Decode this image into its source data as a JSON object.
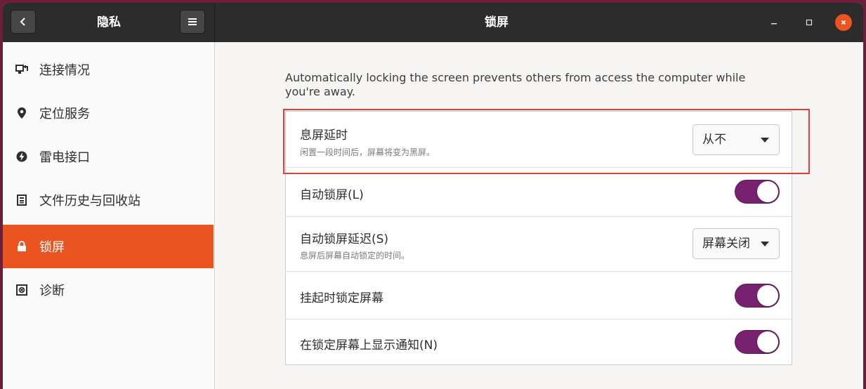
{
  "header": {
    "left_title": "隐私",
    "title": "锁屏"
  },
  "sidebar": {
    "items": [
      {
        "label": "连接情况",
        "icon": "network-icon"
      },
      {
        "label": "定位服务",
        "icon": "location-pin-icon"
      },
      {
        "label": "雷电接口",
        "icon": "thunderbolt-icon"
      },
      {
        "label": "文件历史与回收站",
        "icon": "file-history-icon"
      },
      {
        "label": "锁屏",
        "icon": "lock-icon",
        "active": true
      },
      {
        "label": "诊断",
        "icon": "diagnostics-icon"
      }
    ]
  },
  "main": {
    "description": "Automatically locking the screen prevents others from access the computer while you're away.",
    "rows": [
      {
        "label": "息屏延时",
        "sub": "闲置一段时间后，屏幕将变为黑屏。",
        "control": "dropdown",
        "value": "从不"
      },
      {
        "label": "自动锁屏(L)",
        "control": "toggle",
        "on": true
      },
      {
        "label": "自动锁屏延迟(S)",
        "sub": "息屏后屏幕自动锁定的时间。",
        "control": "dropdown",
        "value": "屏幕关闭"
      },
      {
        "label": "挂起时锁定屏幕",
        "control": "toggle",
        "on": true
      },
      {
        "label": "在锁定屏幕上显示通知(N)",
        "control": "toggle",
        "on": true
      }
    ]
  },
  "colors": {
    "accent": "#e95420",
    "toggle_on": "#77216f",
    "highlight": "#d9413b"
  }
}
